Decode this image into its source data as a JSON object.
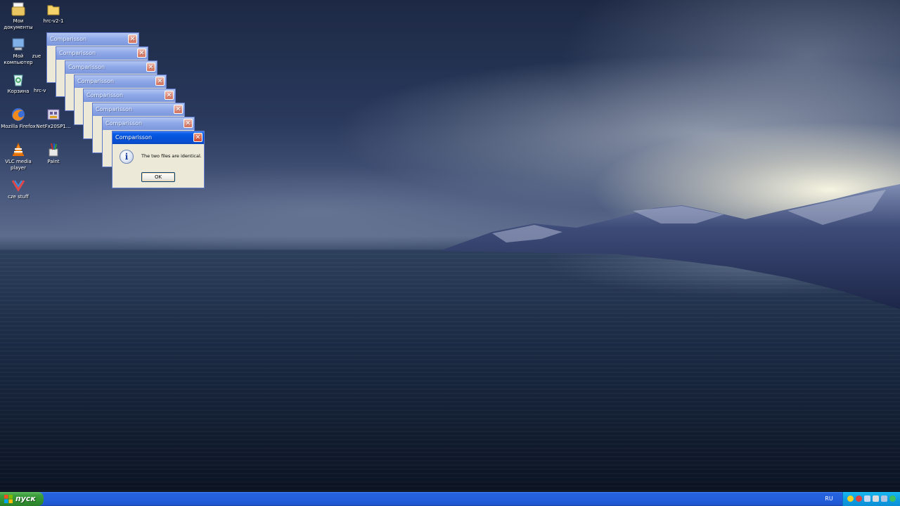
{
  "desktop_icons": [
    {
      "label": "Мои документы",
      "icon": "my-documents-icon"
    },
    {
      "label": "hrc-v2-1",
      "icon": "folder-icon"
    },
    {
      "label": "Мой компьютер",
      "icon": "my-computer-icon"
    },
    {
      "label": "zue",
      "icon": "file-icon"
    },
    {
      "label": "Корзина",
      "icon": "recycle-bin-icon"
    },
    {
      "label": "hrc-v",
      "icon": "file-icon"
    },
    {
      "label": "Mozilla Firefox",
      "icon": "firefox-icon"
    },
    {
      "label": "NetFx20SP1...",
      "icon": "installer-icon"
    },
    {
      "label": "VLC media player",
      "icon": "vlc-icon"
    },
    {
      "label": "Paint",
      "icon": "paint-icon"
    },
    {
      "label": "cze stuff",
      "icon": "shortcut-icon"
    }
  ],
  "dialogs": {
    "title": "Comparisson",
    "close_glyph": "✕",
    "message": "The two files are identical.",
    "ok_label": "OK",
    "info_glyph": "i",
    "stack_count": 8
  },
  "taskbar": {
    "start_label": "пуск",
    "language": "RU"
  },
  "colors": {
    "titlebar_active": "#0a5ce6",
    "titlebar_inactive": "#8fa9e8",
    "taskbar": "#245edb",
    "start_button": "#3c9e3c",
    "tray": "#0f9ee3"
  }
}
